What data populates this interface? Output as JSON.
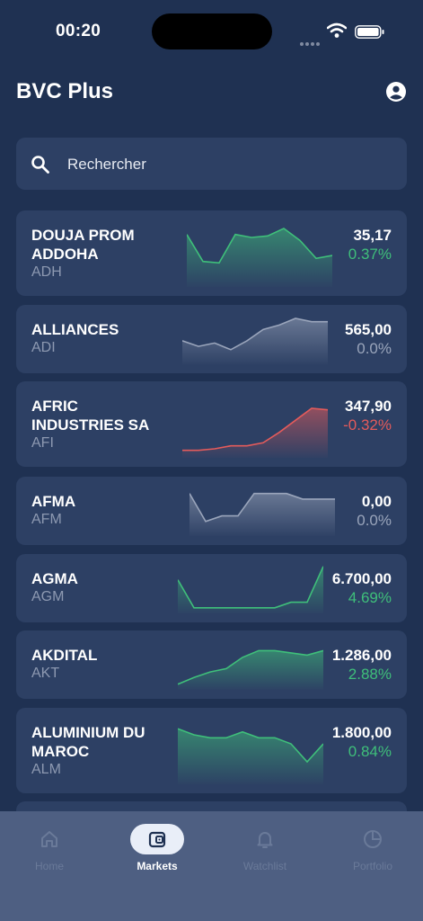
{
  "status": {
    "time": "00:20"
  },
  "header": {
    "title": "BVC Plus"
  },
  "search": {
    "placeholder": "Rechercher"
  },
  "colors": {
    "up": "#3fbf7a",
    "down": "#e45b5b",
    "flat": "#9aa5bb"
  },
  "stocks": [
    {
      "name": "DOUJA PROM ADDOHA",
      "ticker": "ADH",
      "price": "35,17",
      "change": "0.37%",
      "trend": "up",
      "spark": [
        5.0,
        3.2,
        3.1,
        5.0,
        4.8,
        4.9,
        5.4,
        4.6,
        3.4,
        3.6
      ]
    },
    {
      "name": "ALLIANCES",
      "ticker": "ADI",
      "price": "565,00",
      "change": "0.0%",
      "trend": "flat",
      "spark": [
        3.6,
        3.1,
        3.4,
        2.8,
        3.6,
        4.6,
        5.0,
        5.6,
        5.3,
        5.3
      ]
    },
    {
      "name": "AFRIC INDUSTRIES SA",
      "ticker": "AFI",
      "price": "347,90",
      "change": "-0.32%",
      "trend": "down",
      "spark": [
        2.0,
        2.0,
        2.1,
        2.3,
        2.3,
        2.5,
        3.2,
        4.0,
        4.8,
        4.7
      ]
    },
    {
      "name": "AFMA",
      "ticker": "AFM",
      "price": "0,00",
      "change": "0.0%",
      "trend": "flat",
      "spark": [
        5.3,
        2.8,
        3.3,
        3.3,
        5.3,
        5.3,
        5.3,
        4.8,
        4.8,
        4.8
      ]
    },
    {
      "name": "AGMA",
      "ticker": "AGM",
      "price": "6.700,00",
      "change": "4.69%",
      "trend": "up",
      "spark": [
        4.5,
        2.0,
        2.0,
        2.0,
        2.0,
        2.0,
        2.0,
        2.5,
        2.5,
        5.7
      ]
    },
    {
      "name": "AKDITAL",
      "ticker": "AKT",
      "price": "1.286,00",
      "change": "2.88%",
      "trend": "up",
      "spark": [
        2.0,
        2.6,
        3.1,
        3.4,
        4.4,
        5.0,
        5.0,
        4.8,
        4.6,
        5.0
      ]
    },
    {
      "name": "ALUMINIUM DU MAROC",
      "ticker": "ALM",
      "price": "1.800,00",
      "change": "0.84%",
      "trend": "up",
      "spark": [
        5.2,
        4.8,
        4.6,
        4.6,
        5.0,
        4.6,
        4.6,
        4.2,
        3.0,
        4.2
      ]
    }
  ],
  "tabs": [
    {
      "label": "Home",
      "icon": "home-icon",
      "active": false
    },
    {
      "label": "Markets",
      "icon": "wallet-icon",
      "active": true
    },
    {
      "label": "Watchlist",
      "icon": "bell-icon",
      "active": false
    },
    {
      "label": "Portfolio",
      "icon": "pie-chart-icon",
      "active": false
    }
  ]
}
